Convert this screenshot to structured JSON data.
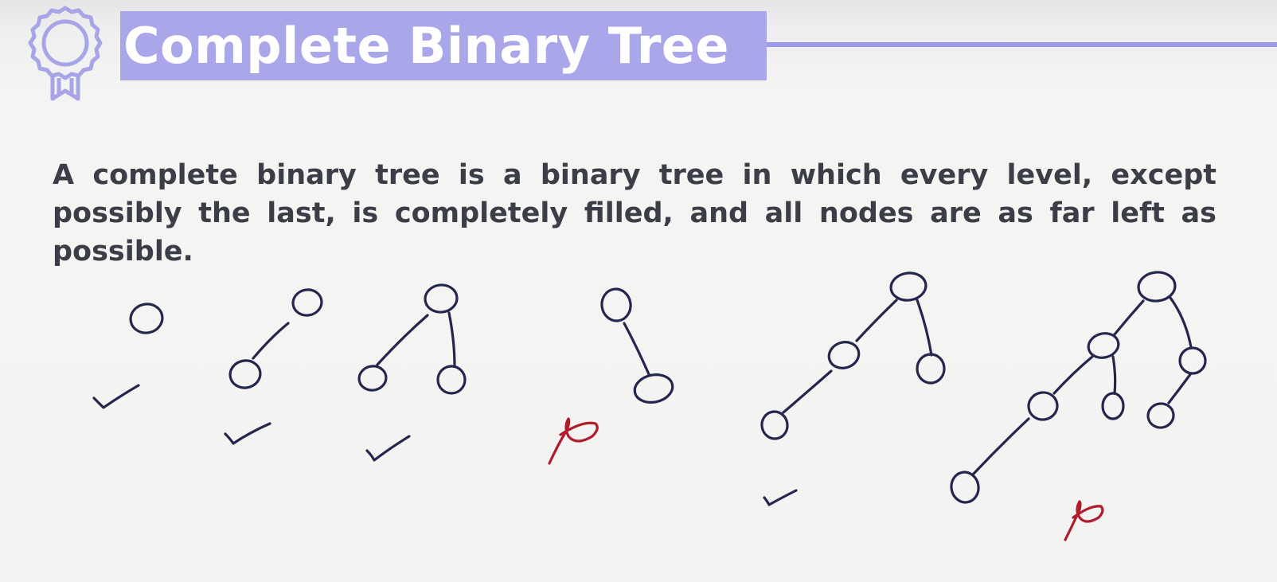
{
  "slide": {
    "title": "Complete Binary Tree",
    "definition": "A complete binary tree is a binary tree in which every level, except possibly the last, is completely filled, and all nodes are as far left as possible."
  },
  "icons": {
    "badge": "award-ribbon-icon"
  },
  "colors": {
    "title_background": "#a9a7ea",
    "title_text": "#ffffff",
    "title_rule": "#9b99e8",
    "body_text": "#3b3e46",
    "ink_blue": "#25264e",
    "ink_red": "#b01c2c"
  },
  "examples": [
    {
      "tree": "single node",
      "verdict": "complete"
    },
    {
      "tree": "root with left child",
      "verdict": "complete"
    },
    {
      "tree": "root with left and right children",
      "verdict": "complete"
    },
    {
      "tree": "root with right child only",
      "verdict": "not complete"
    },
    {
      "tree": "root, left child with left child, right child",
      "verdict": "complete"
    },
    {
      "tree": "four-level tree with gaps in last level",
      "verdict": "not complete"
    }
  ]
}
